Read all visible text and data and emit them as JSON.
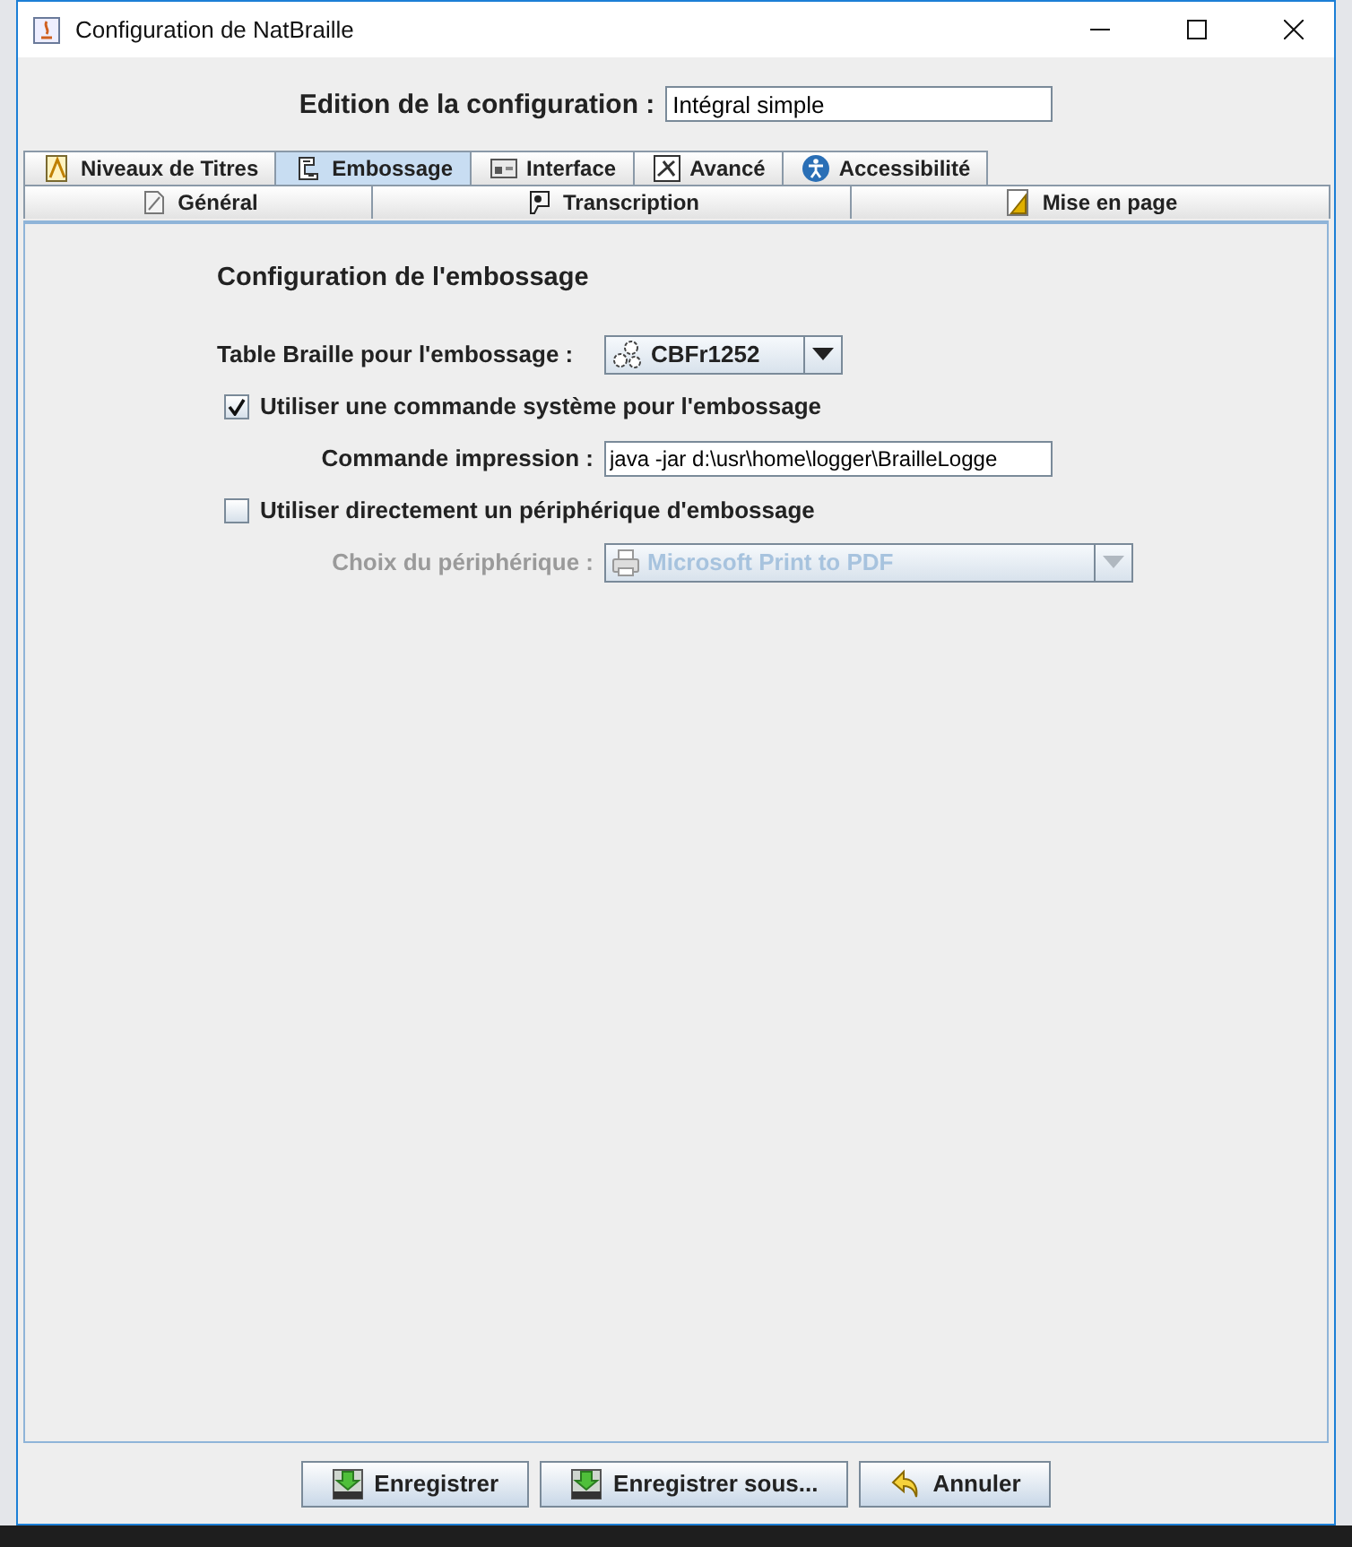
{
  "window": {
    "title": "Configuration de NatBraille"
  },
  "header": {
    "label": "Edition de la configuration :",
    "value": "Intégral simple"
  },
  "tab_rows": [
    {
      "tabs": [
        {
          "label": "Niveaux de Titres",
          "selected": false
        },
        {
          "label": "Embossage",
          "selected": true
        },
        {
          "label": "Interface",
          "selected": false
        },
        {
          "label": "Avancé",
          "selected": false
        },
        {
          "label": "Accessibilité",
          "selected": false
        }
      ]
    },
    {
      "tabs": [
        {
          "label": "Général",
          "selected": false
        },
        {
          "label": "Transcription",
          "selected": false
        },
        {
          "label": "Mise en page",
          "selected": false
        }
      ]
    }
  ],
  "panel": {
    "title": "Configuration de l'embossage",
    "rows": [
      {
        "kind": "combo",
        "label": "Table Braille pour l'embossage :",
        "value": "CBFr1252",
        "disabled": false
      },
      {
        "kind": "checkbox",
        "label": "Utiliser une commande système pour l'embossage",
        "checked": true
      },
      {
        "kind": "field",
        "label": "Commande impression :",
        "value": "java -jar d:\\usr\\home\\logger\\BrailleLogge"
      },
      {
        "kind": "checkbox",
        "label": "Utiliser directement un périphérique d'embossage",
        "checked": false
      },
      {
        "kind": "combo",
        "label": "Choix du périphérique :",
        "value": "Microsoft Print to PDF",
        "disabled": true
      }
    ]
  },
  "buttons": [
    {
      "label": "Enregistrer"
    },
    {
      "label": "Enregistrer sous..."
    },
    {
      "label": "Annuler"
    }
  ]
}
